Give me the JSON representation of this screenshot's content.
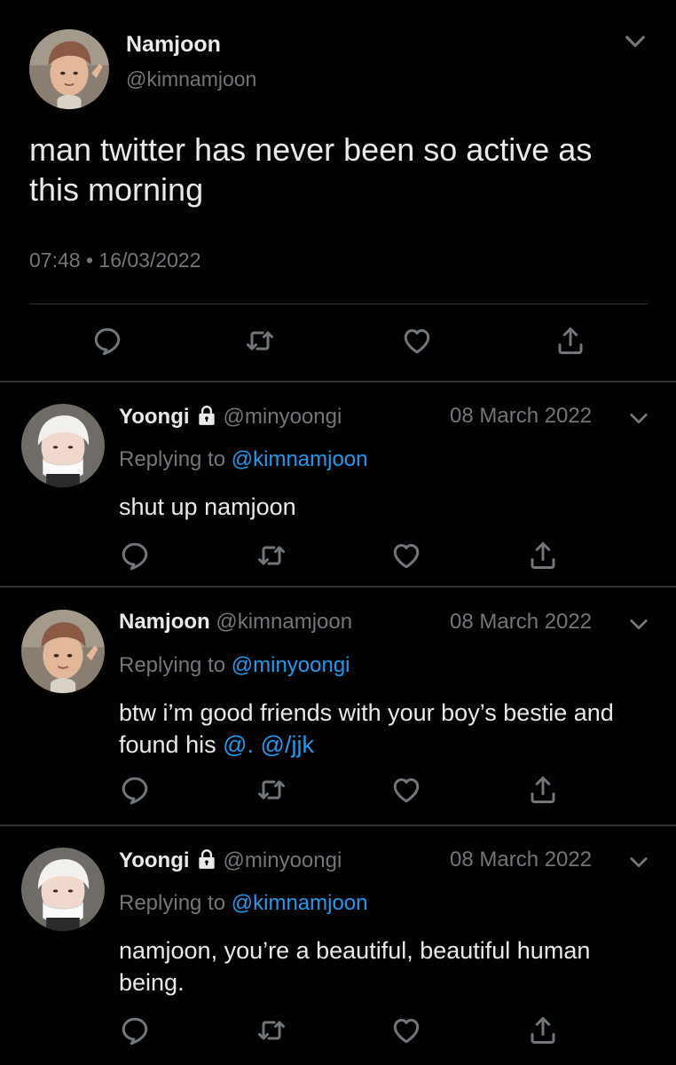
{
  "main_tweet": {
    "name": "Namjoon",
    "handle": "@kimnamjoon",
    "text": "man twitter has never been so active as this morning",
    "time": "07:48",
    "dot": "•",
    "date": "16/03/2022"
  },
  "replies": [
    {
      "name": "Yoongi",
      "protected": true,
      "handle": "@minyoongi",
      "date": "08 March 2022",
      "replying_label": "Replying to",
      "replying_to": "@kimnamjoon",
      "text": "shut up namjoon"
    },
    {
      "name": "Namjoon",
      "protected": false,
      "handle": "@kimnamjoon",
      "date": "08 March 2022",
      "replying_label": "Replying to",
      "replying_to": "@minyoongi",
      "text_part1": "btw i’m good friends with your boy’s bestie and found his",
      "text_mention": "@.",
      "text_mention2": "@/jjk"
    },
    {
      "name": "Yoongi",
      "protected": true,
      "handle": "@minyoongi",
      "date": "08 March 2022",
      "replying_label": "Replying to",
      "replying_to": "@kimnamjoon",
      "text": "namjoon, you’re a beautiful, beautiful human being."
    }
  ],
  "icons": [
    "reply-icon",
    "retweet-icon",
    "like-icon",
    "share-icon",
    "chevron-down-icon",
    "lock-icon"
  ],
  "colors": {
    "background": "#000000",
    "text": "#e7e9ea",
    "secondary": "#71767b",
    "link": "#1d9bf0",
    "divider": "#2f3336"
  }
}
